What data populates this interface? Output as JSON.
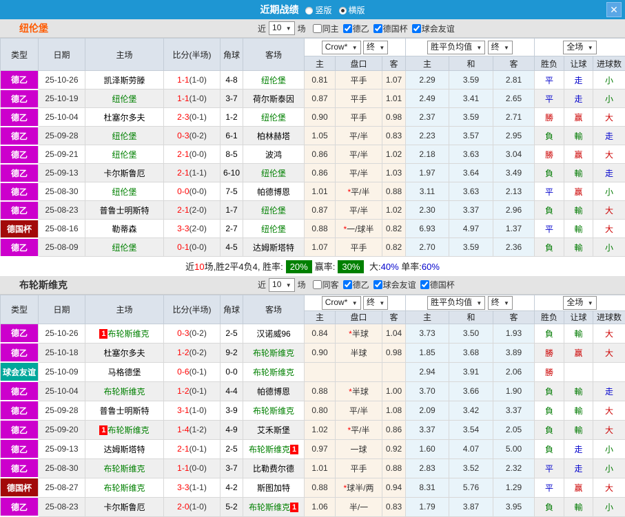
{
  "title_bar": {
    "title": "近期战绩",
    "radios": [
      {
        "label": "竖版",
        "selected": false
      },
      {
        "label": "横版",
        "selected": true
      }
    ],
    "close_label": "✕"
  },
  "table_header": {
    "cols": [
      "类型",
      "日期",
      "主场",
      "比分(半场)",
      "角球",
      "客场"
    ],
    "sub": [
      "主",
      "盘口",
      "客",
      "主",
      "和",
      "客",
      "胜负",
      "让球",
      "进球数"
    ],
    "odds_select": "Crow*",
    "final_select": "终",
    "mean_select": "胜平负均值",
    "scope_select": "全场"
  },
  "colors": {
    "type": {
      "德乙": "#CC00CC",
      "德国杯": "#A20A0A",
      "球会友谊": "#00A79B"
    }
  },
  "sections": [
    {
      "team": "纽伦堡",
      "team_color": "#FF5A00",
      "filter": {
        "near": "近",
        "count": "10",
        "games": "场",
        "same": {
          "label": "同主",
          "checked": false
        },
        "leagues": [
          {
            "label": "德乙",
            "checked": true
          },
          {
            "label": "德国杯",
            "checked": true
          },
          {
            "label": "球会友谊",
            "checked": true
          }
        ]
      },
      "rows": [
        {
          "type": "德乙",
          "date": "25-10-26",
          "home": "凯泽斯劳滕",
          "hg": false,
          "hb": "",
          "score": "1-1",
          "half": "(1-0)",
          "corner": "4-8",
          "away": "纽伦堡",
          "ag": true,
          "ab": "",
          "o1": "0.81",
          "star": false,
          "hcap": "平手",
          "o2": "1.07",
          "m1": "2.29",
          "m2": "3.59",
          "m3": "2.81",
          "r1": "平",
          "r2": "走",
          "r3": "小"
        },
        {
          "type": "德乙",
          "date": "25-10-19",
          "home": "纽伦堡",
          "hg": true,
          "hb": "",
          "score": "1-1",
          "half": "(1-0)",
          "corner": "3-7",
          "away": "荷尔斯泰因",
          "ag": false,
          "ab": "",
          "o1": "0.87",
          "star": false,
          "hcap": "平手",
          "o2": "1.01",
          "m1": "2.49",
          "m2": "3.41",
          "m3": "2.65",
          "r1": "平",
          "r2": "走",
          "r3": "小"
        },
        {
          "type": "德乙",
          "date": "25-10-04",
          "home": "杜塞尔多夫",
          "hg": false,
          "hb": "",
          "score": "2-3",
          "half": "(0-1)",
          "corner": "1-2",
          "away": "纽伦堡",
          "ag": true,
          "ab": "",
          "o1": "0.90",
          "star": false,
          "hcap": "平手",
          "o2": "0.98",
          "m1": "2.37",
          "m2": "3.59",
          "m3": "2.71",
          "r1": "勝",
          "r2": "赢",
          "r3": "大"
        },
        {
          "type": "德乙",
          "date": "25-09-28",
          "home": "纽伦堡",
          "hg": true,
          "hb": "",
          "score": "0-3",
          "half": "(0-2)",
          "corner": "6-1",
          "away": "柏林赫塔",
          "ag": false,
          "ab": "",
          "o1": "1.05",
          "star": false,
          "hcap": "平/半",
          "o2": "0.83",
          "m1": "2.23",
          "m2": "3.57",
          "m3": "2.95",
          "r1": "負",
          "r2": "輸",
          "r3": "走"
        },
        {
          "type": "德乙",
          "date": "25-09-21",
          "home": "纽伦堡",
          "hg": true,
          "hb": "",
          "score": "2-1",
          "half": "(0-0)",
          "corner": "8-5",
          "away": "波鸿",
          "ag": false,
          "ab": "",
          "o1": "0.86",
          "star": false,
          "hcap": "平/半",
          "o2": "1.02",
          "m1": "2.18",
          "m2": "3.63",
          "m3": "3.04",
          "r1": "勝",
          "r2": "赢",
          "r3": "大"
        },
        {
          "type": "德乙",
          "date": "25-09-13",
          "home": "卡尔斯鲁厄",
          "hg": false,
          "hb": "",
          "score": "2-1",
          "half": "(1-1)",
          "corner": "6-10",
          "away": "纽伦堡",
          "ag": true,
          "ab": "",
          "o1": "0.86",
          "star": false,
          "hcap": "平/半",
          "o2": "1.03",
          "m1": "1.97",
          "m2": "3.64",
          "m3": "3.49",
          "r1": "負",
          "r2": "輸",
          "r3": "走"
        },
        {
          "type": "德乙",
          "date": "25-08-30",
          "home": "纽伦堡",
          "hg": true,
          "hb": "",
          "score": "0-0",
          "half": "(0-0)",
          "corner": "7-5",
          "away": "帕德博恩",
          "ag": false,
          "ab": "",
          "o1": "1.01",
          "star": true,
          "hcap": "平/半",
          "o2": "0.88",
          "m1": "3.11",
          "m2": "3.63",
          "m3": "2.13",
          "r1": "平",
          "r2": "赢",
          "r3": "小"
        },
        {
          "type": "德乙",
          "date": "25-08-23",
          "home": "普鲁士明斯特",
          "hg": false,
          "hb": "",
          "score": "2-1",
          "half": "(2-0)",
          "corner": "1-7",
          "away": "纽伦堡",
          "ag": true,
          "ab": "",
          "o1": "0.87",
          "star": false,
          "hcap": "平/半",
          "o2": "1.02",
          "m1": "2.30",
          "m2": "3.37",
          "m3": "2.96",
          "r1": "負",
          "r2": "輸",
          "r3": "大"
        },
        {
          "type": "德国杯",
          "date": "25-08-16",
          "home": "勒蒂森",
          "hg": false,
          "hb": "",
          "score": "3-3",
          "half": "(2-0)",
          "corner": "2-7",
          "away": "纽伦堡",
          "ag": true,
          "ab": "",
          "o1": "0.88",
          "star": true,
          "hcap": "一/球半",
          "o2": "0.82",
          "m1": "6.93",
          "m2": "4.97",
          "m3": "1.37",
          "r1": "平",
          "r2": "輸",
          "r3": "大"
        },
        {
          "type": "德乙",
          "date": "25-08-09",
          "home": "纽伦堡",
          "hg": true,
          "hb": "",
          "score": "0-1",
          "half": "(0-0)",
          "corner": "4-5",
          "away": "达姆斯塔特",
          "ag": false,
          "ab": "",
          "o1": "1.07",
          "star": false,
          "hcap": "平手",
          "o2": "0.82",
          "m1": "2.70",
          "m2": "3.59",
          "m3": "2.36",
          "r1": "負",
          "r2": "輸",
          "r3": "小"
        }
      ],
      "summary": {
        "near": "近",
        "count": "10",
        "rest": "场,胜2平4负4, 胜率:",
        "win": "20%",
        "profit_label": "赢率:",
        "profit": "30%",
        "big_label": "大:",
        "big": "40%",
        "single_label": "单率:",
        "single": "60%"
      }
    },
    {
      "team": "布轮斯维克",
      "team_color": "#333333",
      "filter": {
        "near": "近",
        "count": "10",
        "games": "场",
        "same": {
          "label": "同客",
          "checked": false
        },
        "leagues": [
          {
            "label": "德乙",
            "checked": true
          },
          {
            "label": "球会友谊",
            "checked": true
          },
          {
            "label": "德国杯",
            "checked": true
          }
        ]
      },
      "rows": [
        {
          "type": "德乙",
          "date": "25-10-26",
          "home": "布轮斯维克",
          "hg": true,
          "hb": "1",
          "score": "0-3",
          "half": "(0-2)",
          "corner": "2-5",
          "away": "汉诺威96",
          "ag": false,
          "ab": "",
          "o1": "0.84",
          "star": true,
          "hcap": "半球",
          "o2": "1.04",
          "m1": "3.73",
          "m2": "3.50",
          "m3": "1.93",
          "r1": "負",
          "r2": "輸",
          "r3": "大"
        },
        {
          "type": "德乙",
          "date": "25-10-18",
          "home": "杜塞尔多夫",
          "hg": false,
          "hb": "",
          "score": "1-2",
          "half": "(0-2)",
          "corner": "9-2",
          "away": "布轮斯维克",
          "ag": true,
          "ab": "",
          "o1": "0.90",
          "star": false,
          "hcap": "半球",
          "o2": "0.98",
          "m1": "1.85",
          "m2": "3.68",
          "m3": "3.89",
          "r1": "勝",
          "r2": "赢",
          "r3": "大"
        },
        {
          "type": "球会友谊",
          "date": "25-10-09",
          "home": "马格德堡",
          "hg": false,
          "hb": "",
          "score": "0-6",
          "half": "(0-1)",
          "corner": "0-0",
          "away": "布轮斯维克",
          "ag": true,
          "ab": "",
          "o1": "",
          "star": false,
          "hcap": "",
          "o2": "",
          "m1": "2.94",
          "m2": "3.91",
          "m3": "2.06",
          "r1": "勝",
          "r2": "",
          "r3": ""
        },
        {
          "type": "德乙",
          "date": "25-10-04",
          "home": "布轮斯维克",
          "hg": true,
          "hb": "",
          "score": "1-2",
          "half": "(0-1)",
          "corner": "4-4",
          "away": "帕德博恩",
          "ag": false,
          "ab": "",
          "o1": "0.88",
          "star": true,
          "hcap": "半球",
          "o2": "1.00",
          "m1": "3.70",
          "m2": "3.66",
          "m3": "1.90",
          "r1": "負",
          "r2": "輸",
          "r3": "走"
        },
        {
          "type": "德乙",
          "date": "25-09-28",
          "home": "普鲁士明斯特",
          "hg": false,
          "hb": "",
          "score": "3-1",
          "half": "(1-0)",
          "corner": "3-9",
          "away": "布轮斯维克",
          "ag": true,
          "ab": "",
          "o1": "0.80",
          "star": false,
          "hcap": "平/半",
          "o2": "1.08",
          "m1": "2.09",
          "m2": "3.42",
          "m3": "3.37",
          "r1": "負",
          "r2": "輸",
          "r3": "大"
        },
        {
          "type": "德乙",
          "date": "25-09-20",
          "home": "布轮斯维克",
          "hg": true,
          "hb": "1",
          "score": "1-4",
          "half": "(1-2)",
          "corner": "4-9",
          "away": "艾禾斯堡",
          "ag": false,
          "ab": "",
          "o1": "1.02",
          "star": true,
          "hcap": "平/半",
          "o2": "0.86",
          "m1": "3.37",
          "m2": "3.54",
          "m3": "2.05",
          "r1": "負",
          "r2": "輸",
          "r3": "大"
        },
        {
          "type": "德乙",
          "date": "25-09-13",
          "home": "达姆斯塔特",
          "hg": false,
          "hb": "",
          "score": "2-1",
          "half": "(0-1)",
          "corner": "2-5",
          "away": "布轮斯维克",
          "ag": true,
          "ab": "1",
          "o1": "0.97",
          "star": false,
          "hcap": "一球",
          "o2": "0.92",
          "m1": "1.60",
          "m2": "4.07",
          "m3": "5.00",
          "r1": "負",
          "r2": "走",
          "r3": "小"
        },
        {
          "type": "德乙",
          "date": "25-08-30",
          "home": "布轮斯维克",
          "hg": true,
          "hb": "",
          "score": "1-1",
          "half": "(0-0)",
          "corner": "3-7",
          "away": "比勒费尔德",
          "ag": false,
          "ab": "",
          "o1": "1.01",
          "star": false,
          "hcap": "平手",
          "o2": "0.88",
          "m1": "2.83",
          "m2": "3.52",
          "m3": "2.32",
          "r1": "平",
          "r2": "走",
          "r3": "小"
        },
        {
          "type": "德国杯",
          "date": "25-08-27",
          "home": "布轮斯维克",
          "hg": true,
          "hb": "",
          "score": "3-3",
          "half": "(1-1)",
          "corner": "4-2",
          "away": "斯图加特",
          "ag": false,
          "ab": "",
          "o1": "0.88",
          "star": true,
          "hcap": "球半/两",
          "o2": "0.94",
          "m1": "8.31",
          "m2": "5.76",
          "m3": "1.29",
          "r1": "平",
          "r2": "赢",
          "r3": "大"
        },
        {
          "type": "德乙",
          "date": "25-08-23",
          "home": "卡尔斯鲁厄",
          "hg": false,
          "hb": "",
          "score": "2-0",
          "half": "(1-0)",
          "corner": "5-2",
          "away": "布轮斯维克",
          "ag": true,
          "ab": "1",
          "o1": "1.06",
          "star": false,
          "hcap": "半/一",
          "o2": "0.83",
          "m1": "1.79",
          "m2": "3.87",
          "m3": "3.95",
          "r1": "負",
          "r2": "輸",
          "r3": "小"
        }
      ],
      "summary": null
    }
  ]
}
